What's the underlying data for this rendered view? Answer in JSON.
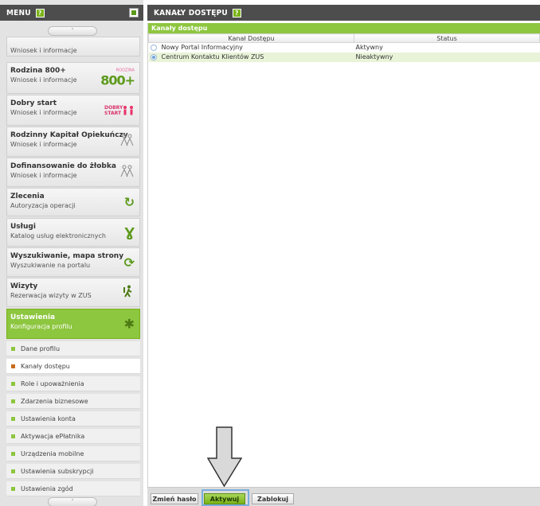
{
  "sidebar": {
    "menu_label": "MENU",
    "help_label": "?",
    "scroll_up_label": "˄",
    "scroll_down_label": "˅",
    "partial_item_sub": "Wniosek i informacje",
    "items": [
      {
        "title": "Rodzina 800+",
        "sub": "Wniosek i informacje",
        "icon": "rodzina-800-logo",
        "logo_text": "800+",
        "logo_small": "RODZINA"
      },
      {
        "title": "Dobry start",
        "sub": "Wniosek i informacje",
        "icon": "dobry-start-logo",
        "logo_text": "DOBRY START"
      },
      {
        "title": "Rodzinny Kapitał Opiekuńczy",
        "sub": "Wniosek i informacje",
        "icon": "family-icon"
      },
      {
        "title": "Dofinansowanie do żłobka",
        "sub": "Wniosek i informacje",
        "icon": "family-icon"
      },
      {
        "title": "Zlecenia",
        "sub": "Autoryzacja operacji",
        "icon": "refresh-icon"
      },
      {
        "title": "Usługi",
        "sub": "Katalog usług elektronicznych",
        "icon": "services-icon"
      },
      {
        "title": "Wyszukiwanie, mapa strony",
        "sub": "Wyszukiwanie na portalu",
        "icon": "search-refresh-icon"
      },
      {
        "title": "Wizyty",
        "sub": "Rezerwacja wizyty w ZUS",
        "icon": "person-icon"
      },
      {
        "title": "Ustawienia",
        "sub": "Konfiguracja profilu",
        "icon": "gear-icon"
      }
    ],
    "sub_items": [
      "Dane profilu",
      "Kanały dostępu",
      "Role i upoważnienia",
      "Zdarzenia biznesowe",
      "Ustawienia konta",
      "Aktywacja ePłatnika",
      "Urządzenia mobilne",
      "Ustawienia subskrypcji",
      "Ustawienia zgód"
    ],
    "selected_sub_item": "Kanały dostępu"
  },
  "main": {
    "header_title": "KANAŁY DOSTĘPU",
    "help_label": "?",
    "section_title": "Kanały dostępu",
    "columns": [
      "Kanał Dostępu",
      "Status"
    ],
    "rows": [
      {
        "channel": "Nowy Portal Informacyjny",
        "status": "Aktywny",
        "selected": false
      },
      {
        "channel": "Centrum Kontaktu Klientów ZUS",
        "status": "Nieaktywny",
        "selected": true
      }
    ]
  },
  "footer": {
    "change_password_label": "Zmień hasło",
    "activate_label": "Aktywuj",
    "block_label": "Zablokuj"
  },
  "colors": {
    "accent_green": "#8dc63f",
    "header_dark": "#4d4d4d",
    "sidebar_bg": "#e3e3e3",
    "arrow_fill": "#d9d9d9"
  }
}
